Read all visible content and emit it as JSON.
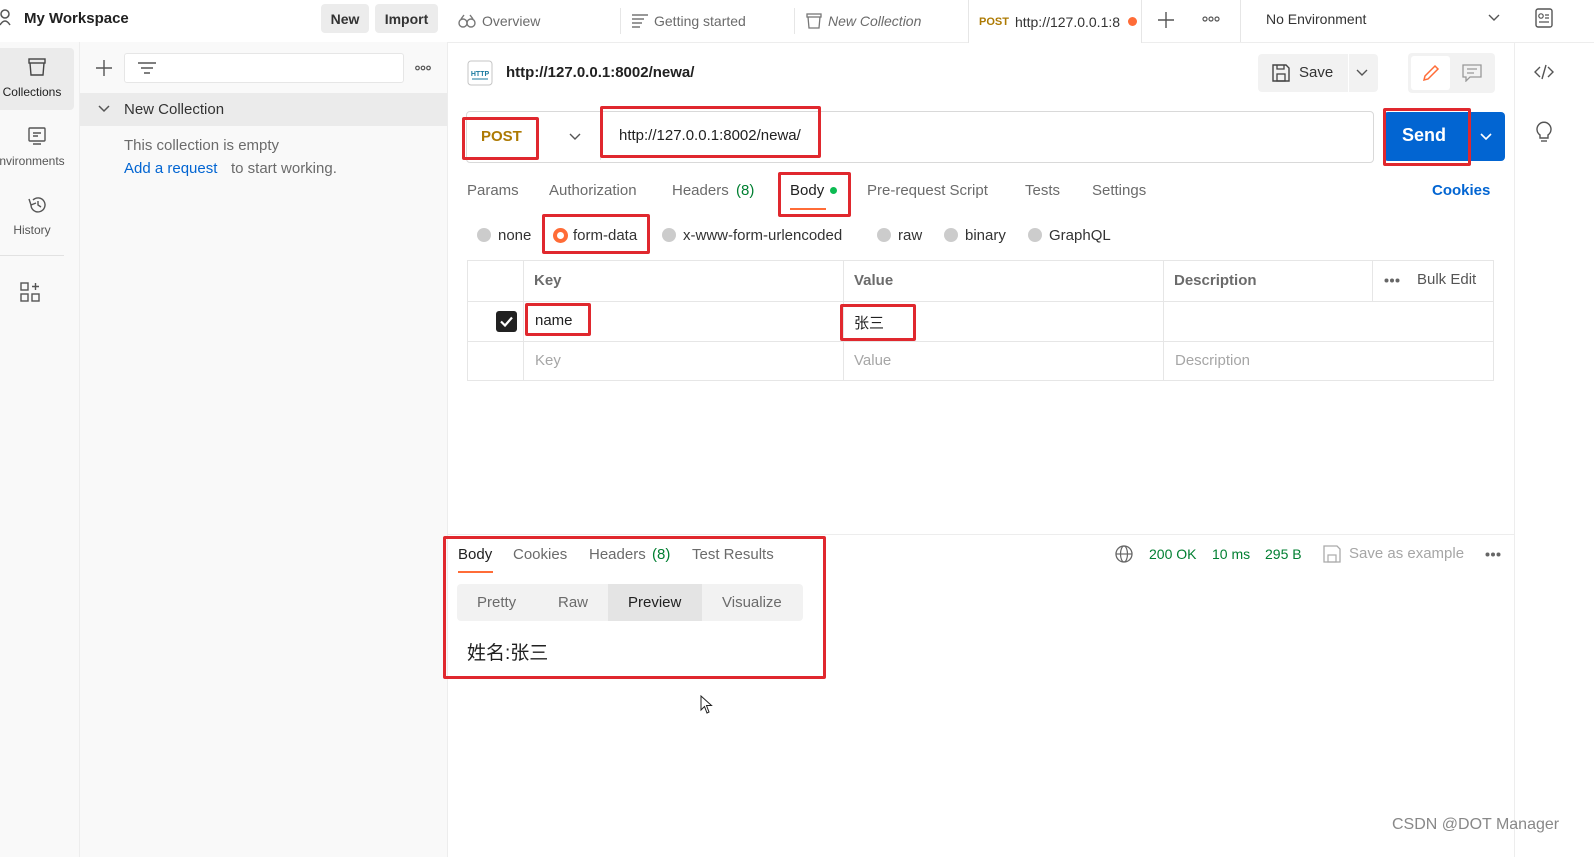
{
  "workspace": {
    "title": "My Workspace",
    "new_label": "New",
    "import_label": "Import"
  },
  "rail": {
    "collections": "Collections",
    "environments": "nvironments",
    "history": "History"
  },
  "sidebar": {
    "collection_name": "New Collection",
    "empty_text": "This collection is empty",
    "add_request": "Add a request",
    "start_text": "to start working."
  },
  "tabs": [
    {
      "label": "Overview"
    },
    {
      "label": "Getting started"
    },
    {
      "label": "New Collection"
    },
    {
      "method": "POST",
      "label": "http://127.0.0.1:8"
    }
  ],
  "environment": {
    "selected": "No Environment"
  },
  "request": {
    "title": "http://127.0.0.1:8002/newa/",
    "save_label": "Save",
    "method": "POST",
    "url": "http://127.0.0.1:8002/newa/",
    "send_label": "Send"
  },
  "req_tabs": {
    "params": "Params",
    "authorization": "Authorization",
    "headers": "Headers",
    "headers_count": "(8)",
    "body": "Body",
    "prerequest": "Pre-request Script",
    "tests": "Tests",
    "settings": "Settings",
    "cookies": "Cookies"
  },
  "body_types": {
    "none": "none",
    "form_data": "form-data",
    "urlencoded": "x-www-form-urlencoded",
    "raw": "raw",
    "binary": "binary",
    "graphql": "GraphQL"
  },
  "form_table": {
    "headers": {
      "key": "Key",
      "value": "Value",
      "description": "Description",
      "bulk_edit": "Bulk Edit"
    },
    "rows": [
      {
        "key": "name",
        "value": "张三",
        "description": ""
      }
    ],
    "placeholders": {
      "key": "Key",
      "value": "Value",
      "description": "Description"
    }
  },
  "response": {
    "tabs": {
      "body": "Body",
      "cookies": "Cookies",
      "headers": "Headers",
      "headers_count": "(8)",
      "test_results": "Test Results"
    },
    "status": "200 OK",
    "time": "10 ms",
    "size": "295 B",
    "save_example": "Save as example",
    "views": {
      "pretty": "Pretty",
      "raw": "Raw",
      "preview": "Preview",
      "visualize": "Visualize"
    },
    "preview_text": "姓名:张三"
  },
  "watermark": "CSDN @DOT Manager",
  "colors": {
    "accent": "#ff6c37",
    "send": "#0265d2",
    "highlight": "#e0282e",
    "success": "#007f31",
    "link": "#0265d2"
  }
}
